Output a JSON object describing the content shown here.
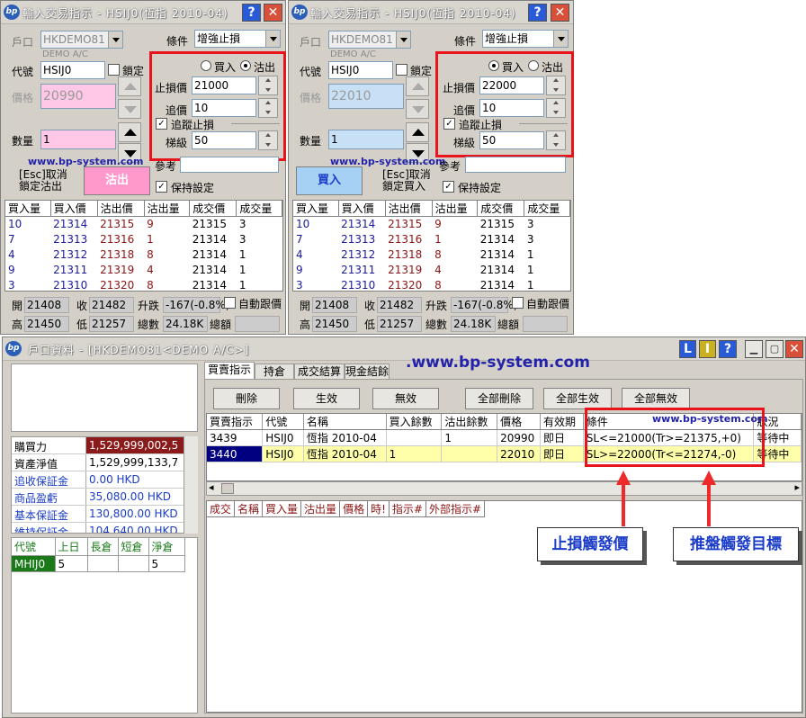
{
  "order_windows": [
    {
      "title": "輸入交易指示 - HSIJ0(恆指 2010-04)",
      "account_label": "戶口",
      "account": "HKDEMO81",
      "account_sub": "DEMO A/C",
      "condition_label": "條件",
      "condition": "增強止損",
      "code_label": "代號",
      "code": "HSIJ0",
      "lock_label": "鎖定",
      "price_label": "價格",
      "price": "20990",
      "qty_label": "數量",
      "qty": "1",
      "buy_label": "買入",
      "sell_label": "沽出",
      "side": "sell",
      "stop_price_label": "止損價",
      "stop_price": "21000",
      "chase_label": "追價",
      "chase": "10",
      "trailing_label": "追蹤止損",
      "trailing": true,
      "step_label": "梯級",
      "step": "50",
      "watermark": "www.bp-system.com",
      "esc_line1": "[Esc]取消",
      "esc_line2": "鎖定沽出",
      "action": "沽出",
      "ref_label": "參考",
      "keep_label": "保持設定",
      "keep": true
    },
    {
      "title": "輸入交易指示 - HSIJ0(恆指 2010-04)",
      "account_label": "戶口",
      "account": "HKDEMO81",
      "account_sub": "DEMO A/C",
      "condition_label": "條件",
      "condition": "增強止損",
      "code_label": "代號",
      "code": "HSIJ0",
      "lock_label": "鎖定",
      "price_label": "價格",
      "price": "22010",
      "qty_label": "數量",
      "qty": "1",
      "buy_label": "買入",
      "sell_label": "沽出",
      "side": "buy",
      "stop_price_label": "止損價",
      "stop_price": "22000",
      "chase_label": "追價",
      "chase": "10",
      "trailing_label": "追蹤止損",
      "trailing": true,
      "step_label": "梯級",
      "step": "50",
      "watermark": "www.bp-system.com",
      "esc_line1": "[Esc]取消",
      "esc_line2": "鎖定買入",
      "action": "買入",
      "ref_label": "參考",
      "keep_label": "保持設定",
      "keep": true
    }
  ],
  "depth_headers": [
    "買入量",
    "買入價",
    "沽出價",
    "沽出量",
    "成交價",
    "成交量"
  ],
  "depth_rows": [
    [
      "10",
      "21314",
      "21315",
      "9",
      "21315",
      "3"
    ],
    [
      "7",
      "21313",
      "21316",
      "1",
      "21314",
      "3"
    ],
    [
      "4",
      "21312",
      "21318",
      "8",
      "21314",
      "1"
    ],
    [
      "9",
      "21311",
      "21319",
      "4",
      "21314",
      "1"
    ],
    [
      "3",
      "21310",
      "21320",
      "8",
      "21314",
      "1"
    ]
  ],
  "stats": {
    "open_label": "開",
    "open": "21408",
    "close_label": "收",
    "close": "21482",
    "chg_label": "升跌",
    "chg": "-167(-0.8%)",
    "auto_label": "自動跟價",
    "high_label": "高",
    "high": "21450",
    "low_label": "低",
    "low": "21257",
    "vol_label": "總數",
    "vol": "24.18K",
    "amt_label": "總額"
  },
  "account_window": {
    "title": "戶口資料 - [HKDEMO81<DEMO A/C>]",
    "tb_buttons": [
      "L",
      "I",
      "?"
    ],
    "info_rows": [
      [
        "購買力",
        "1,529,999,002,5"
      ],
      [
        "資產淨值",
        "1,529,999,133,7"
      ],
      [
        "追收保証金",
        "0.00 HKD"
      ],
      [
        "商品盈虧",
        "35,080.00 HKD"
      ],
      [
        "基本保証金",
        "130,800.00 HKD"
      ],
      [
        "維持保証金",
        "104,640.00 HKD"
      ]
    ],
    "pos_headers": [
      "代號",
      "上日",
      "長倉",
      "短倉",
      "淨倉"
    ],
    "pos_row": [
      "MHIJ0",
      "5",
      "",
      "",
      "5"
    ],
    "tabs": [
      "買賣指示",
      "持倉",
      "成交結算",
      "現金結餘"
    ],
    "watermark": ".www.bp-system.com",
    "action_buttons": [
      "刪除",
      "生效",
      "無效",
      "全部刪除",
      "全部生效",
      "全部無效"
    ],
    "order_headers": [
      "買賣指示",
      "代號",
      "名稱",
      "買入餘數",
      "沽出餘數",
      "價格",
      "有效期",
      "條件",
      "狀況"
    ],
    "order_rows": [
      [
        "3439",
        "HSIJ0",
        "恆指 2010-04",
        "",
        "1",
        "20990",
        "即日",
        "SL<=21000(Tr>=21375,+0)",
        "等待中"
      ],
      [
        "3440",
        "HSIJ0",
        "恆指 2010-04",
        "1",
        "",
        "22010",
        "即日",
        "SL>=22000(Tr<=21274,-0)",
        "等待中"
      ]
    ],
    "cond_watermark": "www.bp-system.com",
    "trade_headers": [
      "成交",
      "名稱",
      "買入量",
      "沽出量",
      "價格",
      "時!",
      "指示#",
      "外部指示#"
    ]
  },
  "callouts": {
    "stop_trigger": "止損觸發價",
    "trail_trigger": "推盤觸發目標"
  },
  "colors": {
    "accent_red": "#e8141b",
    "callout_blue": "#1a3cc8",
    "sell_pink": "#ff99cc",
    "buy_blue": "#a6d1f5",
    "selected_row": "#000080",
    "row_yellow": "#ffffaa"
  }
}
